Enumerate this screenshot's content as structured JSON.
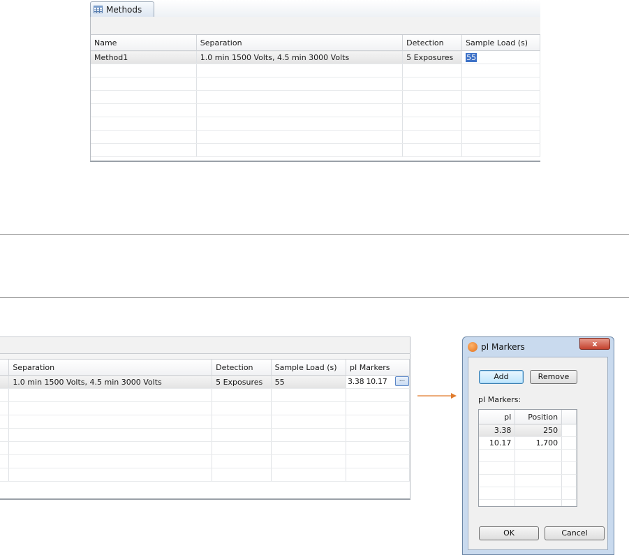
{
  "top_panel": {
    "tab_label": "Methods",
    "columns": [
      "Name",
      "Separation",
      "Detection",
      "Sample Load (s)"
    ],
    "rows": [
      [
        "Method1",
        "1.0 min 1500 Volts, 4.5 min 3000 Volts",
        "5 Exposures",
        "55"
      ]
    ],
    "empty_rows": 7,
    "editing_value": "55"
  },
  "bottom_panel": {
    "columns": [
      "Separation",
      "Detection",
      "Sample Load (s)",
      "pI Markers"
    ],
    "rows": [
      [
        "1.0 min 1500 Volts, 4.5 min 3000 Volts",
        "5 Exposures",
        "55",
        "3.38  10.17"
      ]
    ],
    "ellipsis_label": "...",
    "empty_rows": 7
  },
  "arrow_color": "#e07b2c",
  "dialog": {
    "title": "pI Markers",
    "close_label": "x",
    "add_label": "Add",
    "remove_label": "Remove",
    "markers_label": "pI Markers:",
    "columns": [
      "pI",
      "Position"
    ],
    "rows": [
      [
        "3.38",
        "250"
      ],
      [
        "10.17",
        "1,700"
      ]
    ],
    "empty_rows": 5,
    "ok_label": "OK",
    "cancel_label": "Cancel"
  }
}
